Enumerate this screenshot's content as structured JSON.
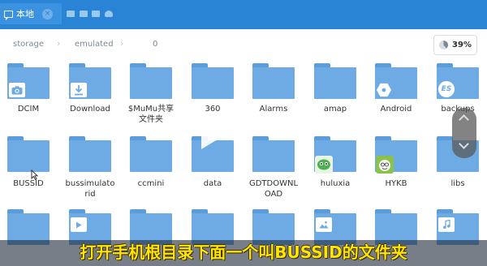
{
  "topbar": {
    "tab_label": "本地",
    "tab_close": "×"
  },
  "breadcrumb": {
    "items": [
      "storage",
      "emulated",
      "0"
    ],
    "separator": "›"
  },
  "storage": {
    "percent": "39%",
    "used_fraction": 0.39
  },
  "folders": {
    "dcim": "DCIM",
    "download": "Download",
    "mumu": "$MuMu共享\n文件夹",
    "n360": "360",
    "alarms": "Alarms",
    "amap": "amap",
    "android": "Android",
    "backups": "backups",
    "bussid": "BUSSID",
    "bussimulator": "bussimulato\nrid",
    "ccmini": "ccmini",
    "data": "data",
    "gdtdownload": "GDTDOWNL\nOAD",
    "huluxia": "huluxia",
    "hykb": "HYKB",
    "libs": "libs"
  },
  "subtitle": "打开手机根目录下面一个叫BUSSID的文件夹",
  "colors": {
    "topbar": "#2a84d6",
    "folder": "#6eaae3",
    "subtitle": "#ffe600"
  }
}
